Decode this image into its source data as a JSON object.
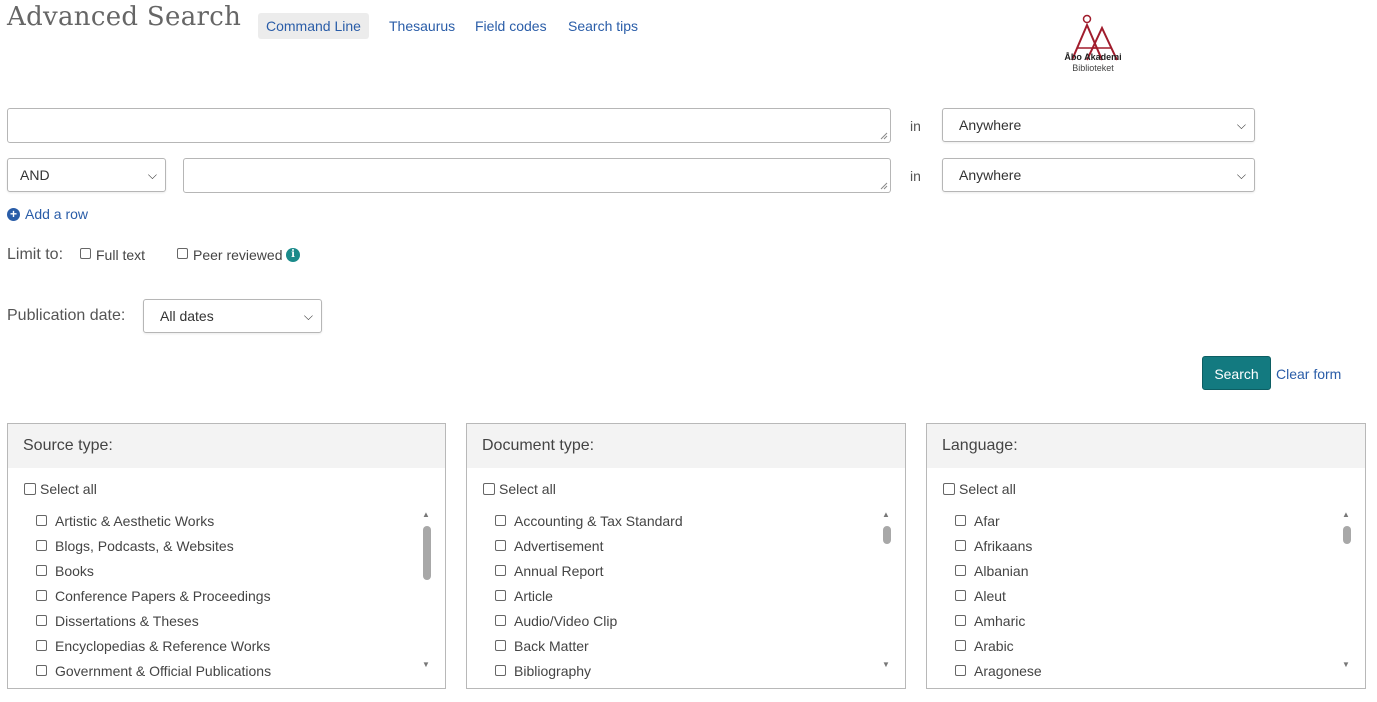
{
  "header": {
    "title": "Advanced Search",
    "tabs": [
      "Command Line",
      "Thesaurus",
      "Field codes",
      "Search tips"
    ],
    "logo": {
      "name": "Åbo Akademi",
      "sub": "Biblioteket",
      "color": "#a01c2c"
    }
  },
  "search_rows": [
    {
      "operator": "",
      "value": "",
      "in_label": "in",
      "field": "Anywhere"
    },
    {
      "operator": "AND",
      "value": "",
      "in_label": "in",
      "field": "Anywhere"
    }
  ],
  "add_row_label": "Add a row",
  "limit": {
    "label": "Limit to:",
    "full_text": "Full text",
    "peer_reviewed": "Peer reviewed"
  },
  "publication_date": {
    "label": "Publication date:",
    "value": "All dates"
  },
  "actions": {
    "search": "Search",
    "clear": "Clear form"
  },
  "panels": [
    {
      "title": "Source type:",
      "select_all": "Select all",
      "items": [
        "Artistic & Aesthetic Works",
        "Blogs, Podcasts, & Websites",
        "Books",
        "Conference Papers & Proceedings",
        "Dissertations & Theses",
        "Encyclopedias & Reference Works",
        "Government & Official Publications"
      ]
    },
    {
      "title": "Document type:",
      "select_all": "Select all",
      "items": [
        "Accounting & Tax Standard",
        "Advertisement",
        "Annual Report",
        "Article",
        "Audio/Video Clip",
        "Back Matter",
        "Bibliography"
      ]
    },
    {
      "title": "Language:",
      "select_all": "Select all",
      "items": [
        "Afar",
        "Afrikaans",
        "Albanian",
        "Aleut",
        "Amharic",
        "Arabic",
        "Aragonese"
      ]
    }
  ],
  "colors": {
    "link": "#2a5da8",
    "accent": "#137a80",
    "logo": "#a01c2c"
  }
}
